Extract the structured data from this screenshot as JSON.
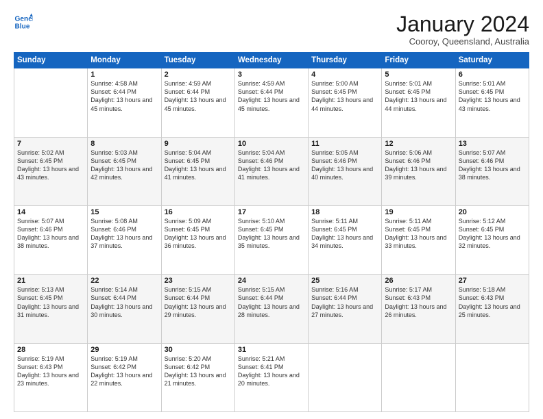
{
  "logo": {
    "line1": "General",
    "line2": "Blue"
  },
  "title": "January 2024",
  "subtitle": "Cooroy, Queensland, Australia",
  "headers": [
    "Sunday",
    "Monday",
    "Tuesday",
    "Wednesday",
    "Thursday",
    "Friday",
    "Saturday"
  ],
  "weeks": [
    [
      {
        "day": "",
        "info": ""
      },
      {
        "day": "1",
        "info": "Sunrise: 4:58 AM\nSunset: 6:44 PM\nDaylight: 13 hours\nand 45 minutes."
      },
      {
        "day": "2",
        "info": "Sunrise: 4:59 AM\nSunset: 6:44 PM\nDaylight: 13 hours\nand 45 minutes."
      },
      {
        "day": "3",
        "info": "Sunrise: 4:59 AM\nSunset: 6:44 PM\nDaylight: 13 hours\nand 45 minutes."
      },
      {
        "day": "4",
        "info": "Sunrise: 5:00 AM\nSunset: 6:45 PM\nDaylight: 13 hours\nand 44 minutes."
      },
      {
        "day": "5",
        "info": "Sunrise: 5:01 AM\nSunset: 6:45 PM\nDaylight: 13 hours\nand 44 minutes."
      },
      {
        "day": "6",
        "info": "Sunrise: 5:01 AM\nSunset: 6:45 PM\nDaylight: 13 hours\nand 43 minutes."
      }
    ],
    [
      {
        "day": "7",
        "info": "Sunrise: 5:02 AM\nSunset: 6:45 PM\nDaylight: 13 hours\nand 43 minutes."
      },
      {
        "day": "8",
        "info": "Sunrise: 5:03 AM\nSunset: 6:45 PM\nDaylight: 13 hours\nand 42 minutes."
      },
      {
        "day": "9",
        "info": "Sunrise: 5:04 AM\nSunset: 6:45 PM\nDaylight: 13 hours\nand 41 minutes."
      },
      {
        "day": "10",
        "info": "Sunrise: 5:04 AM\nSunset: 6:46 PM\nDaylight: 13 hours\nand 41 minutes."
      },
      {
        "day": "11",
        "info": "Sunrise: 5:05 AM\nSunset: 6:46 PM\nDaylight: 13 hours\nand 40 minutes."
      },
      {
        "day": "12",
        "info": "Sunrise: 5:06 AM\nSunset: 6:46 PM\nDaylight: 13 hours\nand 39 minutes."
      },
      {
        "day": "13",
        "info": "Sunrise: 5:07 AM\nSunset: 6:46 PM\nDaylight: 13 hours\nand 38 minutes."
      }
    ],
    [
      {
        "day": "14",
        "info": "Sunrise: 5:07 AM\nSunset: 6:46 PM\nDaylight: 13 hours\nand 38 minutes."
      },
      {
        "day": "15",
        "info": "Sunrise: 5:08 AM\nSunset: 6:46 PM\nDaylight: 13 hours\nand 37 minutes."
      },
      {
        "day": "16",
        "info": "Sunrise: 5:09 AM\nSunset: 6:45 PM\nDaylight: 13 hours\nand 36 minutes."
      },
      {
        "day": "17",
        "info": "Sunrise: 5:10 AM\nSunset: 6:45 PM\nDaylight: 13 hours\nand 35 minutes."
      },
      {
        "day": "18",
        "info": "Sunrise: 5:11 AM\nSunset: 6:45 PM\nDaylight: 13 hours\nand 34 minutes."
      },
      {
        "day": "19",
        "info": "Sunrise: 5:11 AM\nSunset: 6:45 PM\nDaylight: 13 hours\nand 33 minutes."
      },
      {
        "day": "20",
        "info": "Sunrise: 5:12 AM\nSunset: 6:45 PM\nDaylight: 13 hours\nand 32 minutes."
      }
    ],
    [
      {
        "day": "21",
        "info": "Sunrise: 5:13 AM\nSunset: 6:45 PM\nDaylight: 13 hours\nand 31 minutes."
      },
      {
        "day": "22",
        "info": "Sunrise: 5:14 AM\nSunset: 6:44 PM\nDaylight: 13 hours\nand 30 minutes."
      },
      {
        "day": "23",
        "info": "Sunrise: 5:15 AM\nSunset: 6:44 PM\nDaylight: 13 hours\nand 29 minutes."
      },
      {
        "day": "24",
        "info": "Sunrise: 5:15 AM\nSunset: 6:44 PM\nDaylight: 13 hours\nand 28 minutes."
      },
      {
        "day": "25",
        "info": "Sunrise: 5:16 AM\nSunset: 6:44 PM\nDaylight: 13 hours\nand 27 minutes."
      },
      {
        "day": "26",
        "info": "Sunrise: 5:17 AM\nSunset: 6:43 PM\nDaylight: 13 hours\nand 26 minutes."
      },
      {
        "day": "27",
        "info": "Sunrise: 5:18 AM\nSunset: 6:43 PM\nDaylight: 13 hours\nand 25 minutes."
      }
    ],
    [
      {
        "day": "28",
        "info": "Sunrise: 5:19 AM\nSunset: 6:43 PM\nDaylight: 13 hours\nand 23 minutes."
      },
      {
        "day": "29",
        "info": "Sunrise: 5:19 AM\nSunset: 6:42 PM\nDaylight: 13 hours\nand 22 minutes."
      },
      {
        "day": "30",
        "info": "Sunrise: 5:20 AM\nSunset: 6:42 PM\nDaylight: 13 hours\nand 21 minutes."
      },
      {
        "day": "31",
        "info": "Sunrise: 5:21 AM\nSunset: 6:41 PM\nDaylight: 13 hours\nand 20 minutes."
      },
      {
        "day": "",
        "info": ""
      },
      {
        "day": "",
        "info": ""
      },
      {
        "day": "",
        "info": ""
      }
    ]
  ]
}
